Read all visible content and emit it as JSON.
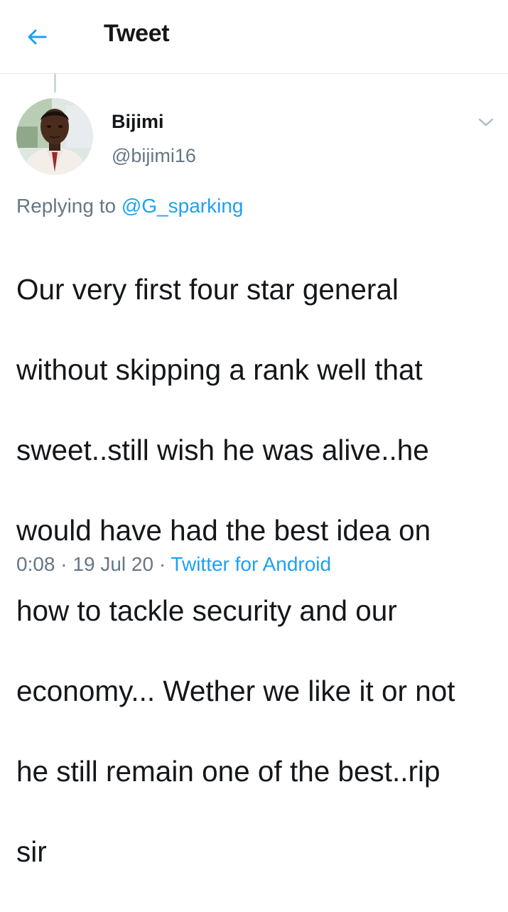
{
  "header": {
    "back_icon": "arrow-left-icon",
    "title": "Tweet"
  },
  "tweet": {
    "author": {
      "display_name": "Bijimi",
      "handle": "@bijimi16",
      "avatar_icon": "avatar-photo"
    },
    "menu_icon": "chevron-down-icon",
    "replying_prefix": "Replying to",
    "replying_to": "@G_sparking",
    "lines": [
      "Our very first four star general",
      "without skipping a rank well that",
      "sweet..still wish he was alive..he",
      "would have had the best idea on",
      "how to tackle security and our",
      "economy... Wether we like it or not",
      "he still remain one of the best..rip",
      "sir"
    ],
    "time": "0:08",
    "date": "19 Jul 20",
    "separator": "·",
    "source": "Twitter for Android"
  },
  "colors": {
    "accent": "#1da1f2",
    "secondary_text": "#657786",
    "primary_text": "#14171a",
    "divider": "#e1e8ed"
  }
}
